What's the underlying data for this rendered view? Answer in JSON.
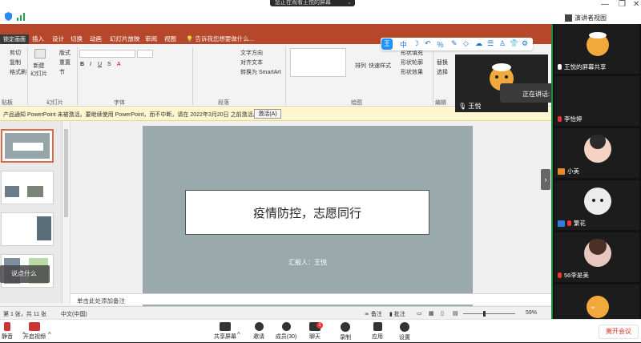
{
  "zoom": {
    "viewing_banner": "您正在观看王悦的屏幕",
    "speaker_view_label": "演讲者视图",
    "speaking_now": "正在讲话: 王悦",
    "active_speaker_name": "王悦",
    "leave_button": "离开会议",
    "say_something": "说点什么",
    "colors": {
      "gallery_border": "#1b8f3c",
      "leave_text": "#d32222",
      "ppt_accent": "#b7472a"
    }
  },
  "ppt": {
    "lock_screen": "锁定画面",
    "tabs": [
      "插入",
      "设计",
      "切换",
      "动画",
      "幻灯片放映",
      "审阅",
      "视图"
    ],
    "tell_me": "告诉我您想要做什么...",
    "ribbon": {
      "paste_items": [
        "剪切",
        "复制",
        "格式刷"
      ],
      "new_slide": "新建\n幻灯片",
      "layout": "版式",
      "reset": "重置",
      "section": "节",
      "text_direction": "文字方向",
      "align_text": "对齐文本",
      "smartart": "转换为 SmartArt",
      "arrange": "排列",
      "quick_styles": "快速样式",
      "shape_fill": "形状填充",
      "shape_outline": "形状轮廓",
      "shape_effects": "形状效果",
      "replace": "替换",
      "select": "选择",
      "groups": [
        "贴板",
        "幻灯片",
        "字体",
        "段落",
        "绘图",
        "编辑"
      ]
    },
    "activation": {
      "message": "产品通知  PowerPoint 未被激活。要继续使用 PowerPoint，而不中断，请在 2022年3月20日 之前激活。",
      "button": "激活(A)"
    },
    "slide": {
      "title": "疫情防控，志愿同行",
      "reporter": "汇报人：王悦"
    },
    "notes_placeholder": "单击此处添加备注",
    "status": {
      "slide_count": "第 1 张，共 11 张",
      "language": "中文(中国)",
      "notes": "备注",
      "comments": "批注",
      "zoom": "59%"
    }
  },
  "gallery": {
    "tiles": [
      {
        "label": "王悦的屏幕共享",
        "mic_on": true
      },
      {
        "label": "李怡婷",
        "mic_on": false
      },
      {
        "label": "小美",
        "mic_on": false
      },
      {
        "label": "繁花",
        "mic_on": false
      },
      {
        "label": "56李是美",
        "mic_on": false
      }
    ]
  },
  "controls": {
    "buttons": [
      "静音",
      "开启视频",
      "共享屏幕",
      "邀请",
      "成员(30)",
      "聊天",
      "录制",
      "应用",
      "设置"
    ],
    "chat_badge": "1"
  },
  "icons": {
    "security": "shield-icon",
    "signal": "signal-icon",
    "annotation_tools": [
      "text-icon",
      "moon-icon",
      "undo-icon",
      "percent-icon",
      "pen-icon",
      "eraser-icon",
      "cloud-icon",
      "list-icon",
      "person-icon",
      "shirt-icon",
      "gear-icon"
    ]
  }
}
